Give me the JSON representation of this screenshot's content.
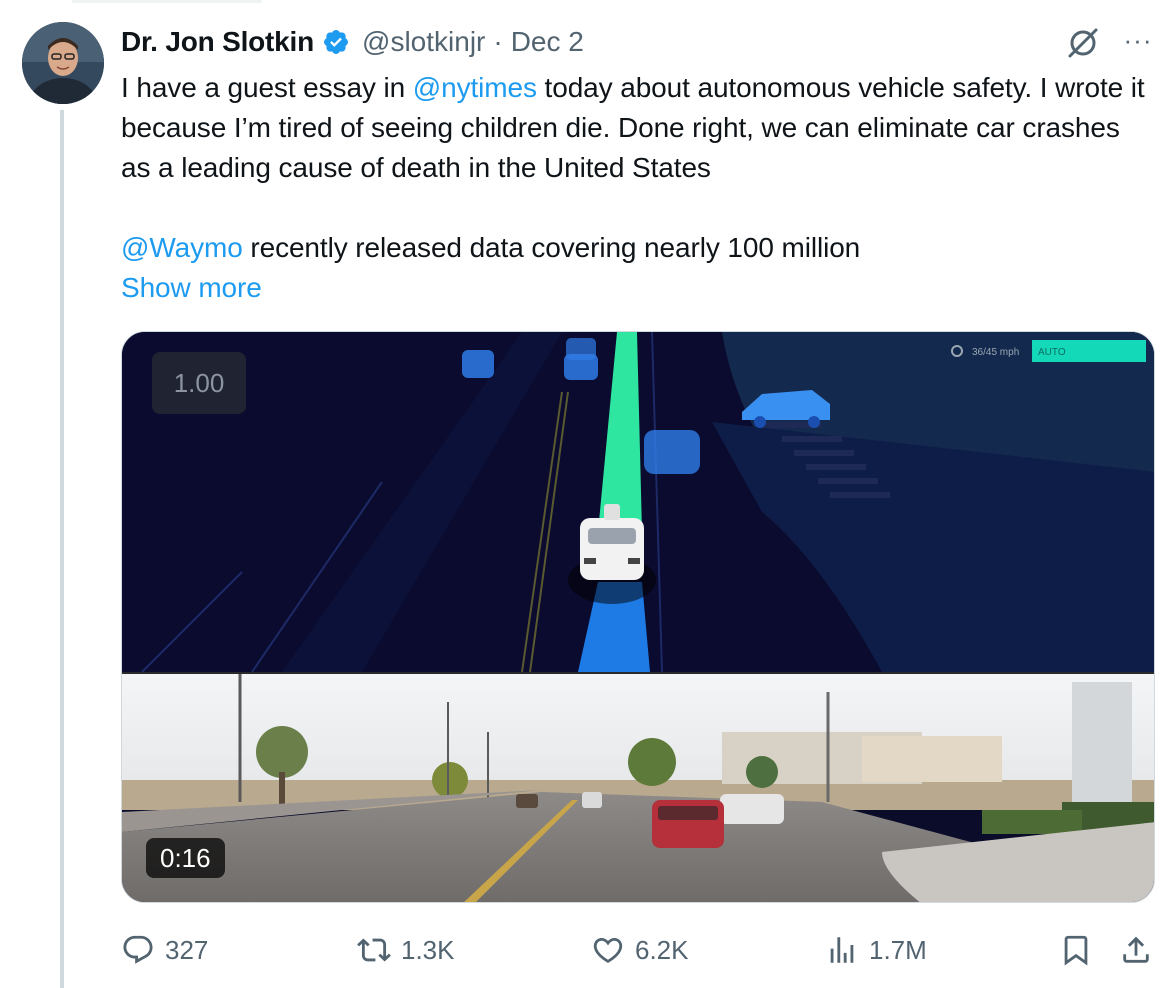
{
  "tweet": {
    "author_name": "Dr. Jon Slotkin",
    "handle": "@slotkinjr",
    "separator": "·",
    "date": "Dec 2",
    "verified": true,
    "more_label": "···",
    "text": {
      "line1_pre": "I have a guest essay in ",
      "line1_mention": "@nytimes",
      "line1_post": " today about autonomous vehicle safety. I wrote it because I’m tired of seeing children die. Done right, we can eliminate car crashes as a leading cause of death in the United States",
      "line2_mention": "@Waymo",
      "line2_post": " recently released data covering nearly 100 million",
      "show_more": "Show more"
    }
  },
  "media": {
    "playback_speed": "1.00",
    "duration": "0:16",
    "hud_speed": "36/45 mph",
    "hud_mode": "AUTO"
  },
  "actions": {
    "replies": "327",
    "reposts": "1.3K",
    "likes": "6.2K",
    "views": "1.7M"
  },
  "icons": {
    "verified": "verified-badge-icon",
    "grok": "grok-icon",
    "reply": "reply-icon",
    "repost": "repost-icon",
    "like": "heart-icon",
    "views": "views-chart-icon",
    "bookmark": "bookmark-icon",
    "share": "share-icon"
  },
  "colors": {
    "accent": "#1d9bf0",
    "text_primary": "#0f1419",
    "text_secondary": "#536471",
    "route_green": "#2ee6a0",
    "route_blue": "#1e7be6",
    "hud_mode_bg": "#14d9b8"
  }
}
